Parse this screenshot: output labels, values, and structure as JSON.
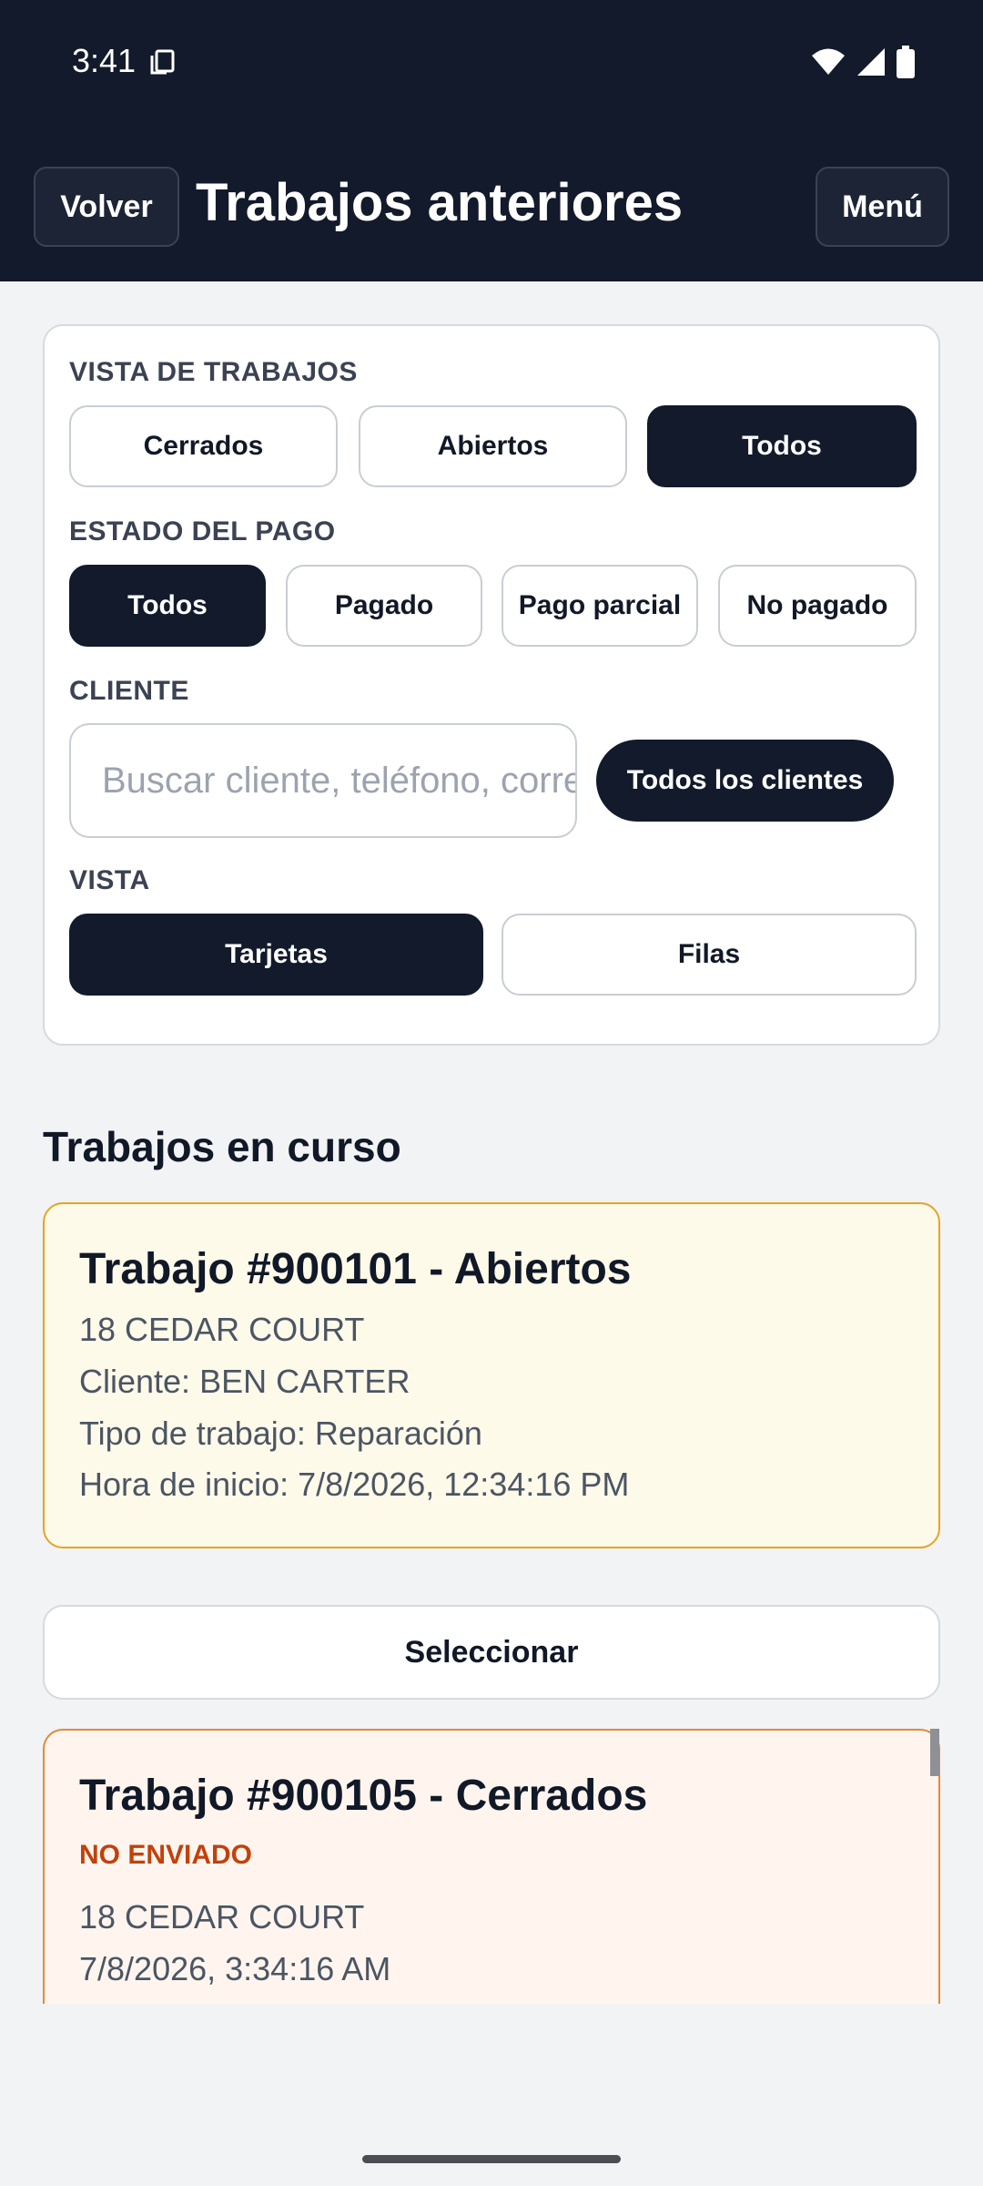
{
  "status_bar": {
    "time": "3:41"
  },
  "header": {
    "back_label": "Volver",
    "title": "Trabajos anteriores",
    "menu_label": "Menú"
  },
  "filters": {
    "jobs_view": {
      "label": "VISTA DE TRABAJOS",
      "options": [
        "Cerrados",
        "Abiertos",
        "Todos"
      ],
      "selected": "Todos"
    },
    "payment_status": {
      "label": "ESTADO DEL PAGO",
      "options": [
        "Todos",
        "Pagado",
        "Pago parcial",
        "No pagado"
      ],
      "selected": "Todos"
    },
    "client": {
      "label": "CLIENTE",
      "search_placeholder": "Buscar cliente, teléfono, correo",
      "all_clients_label": "Todos los clientes"
    },
    "view": {
      "label": "VISTA",
      "options": [
        "Tarjetas",
        "Filas"
      ],
      "selected": "Tarjetas"
    }
  },
  "in_progress": {
    "heading": "Trabajos en curso",
    "jobs": [
      {
        "title": "Trabajo #900101 - Abiertos",
        "address": "18 CEDAR COURT",
        "client": "Cliente: BEN CARTER",
        "job_type": "Tipo de trabajo: Reparación",
        "start_time": "Hora de inicio: 7/8/2026, 12:34:16 PM"
      }
    ]
  },
  "select_label": "Seleccionar",
  "past_jobs": [
    {
      "title": "Trabajo #900105 - Cerrados",
      "flag": "NO ENVIADO",
      "address": "18 CEDAR COURT",
      "date": "7/8/2026, 3:34:16 AM"
    }
  ],
  "colors": {
    "header_bg": "#121a2b",
    "open_card_border": "#e6a424",
    "closed_card_border": "#e28a3a",
    "flag": "#c2410c"
  }
}
